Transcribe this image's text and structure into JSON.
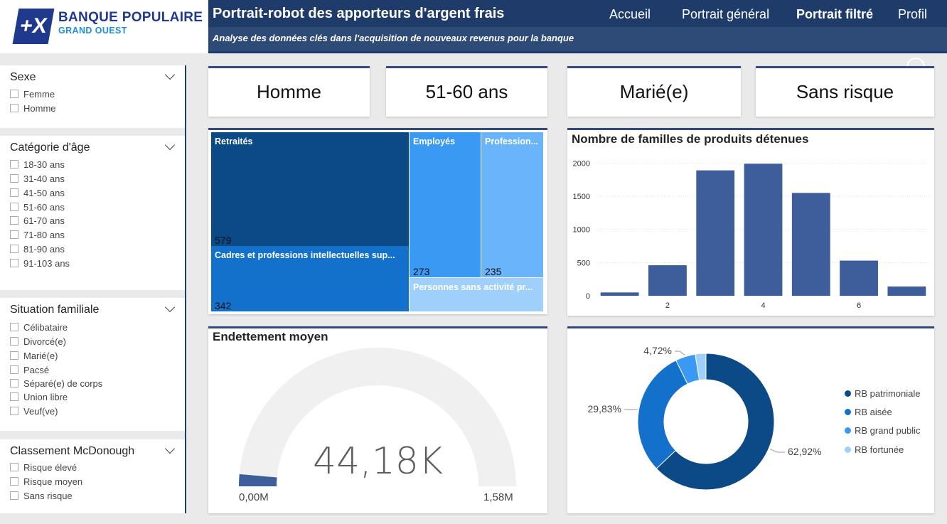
{
  "logo": {
    "mark": "+X",
    "name": "BANQUE POPULAIRE",
    "sub": "GRAND OUEST"
  },
  "header": {
    "title": "Portrait-robot des apporteurs d'argent frais",
    "subtitle": "Analyse des données clés dans l'acquisition de nouveaux revenus pour la banque",
    "nav": [
      "Accueil",
      "Portrait général",
      "Portrait filtré",
      "Profil"
    ],
    "active_nav": "Portrait filtré",
    "back_icon": "arrow-left-circle-icon"
  },
  "slicers": [
    {
      "title": "Sexe",
      "options": [
        "Femme",
        "Homme"
      ]
    },
    {
      "title": "Catégorie d'âge",
      "options": [
        "18-30 ans",
        "31-40 ans",
        "41-50 ans",
        "51-60 ans",
        "61-70 ans",
        "71-80 ans",
        "81-90 ans",
        "91-103 ans"
      ]
    },
    {
      "title": "Situation familiale",
      "options": [
        "Célibataire",
        "Divorcé(e)",
        "Marié(e)",
        "Pacsé",
        "Séparé(e) de corps",
        "Union libre",
        "Veuf(ve)"
      ]
    },
    {
      "title": "Classement McDonough",
      "options": [
        "Risque élevé",
        "Risque moyen",
        "Sans risque"
      ]
    }
  ],
  "cards": [
    "Homme",
    "51-60 ans",
    "Marié(e)",
    "Sans risque"
  ],
  "treemap": {
    "tiles": [
      {
        "label": "Retraités",
        "value": "579",
        "color": "#0b4a86"
      },
      {
        "label": "Cadres et professions intellectuelles sup...",
        "value": "342",
        "color": "#1471cb"
      },
      {
        "label": "Employés",
        "value": "273",
        "color": "#3a9af3"
      },
      {
        "label": "Profession...",
        "value": "235",
        "color": "#69b4fa"
      },
      {
        "label": "Personnes sans activité pr...",
        "value": "",
        "color": "#9fd0fc"
      }
    ]
  },
  "gauge": {
    "title": "Endettement moyen",
    "value_label": "44,18K",
    "min_label": "0,00M",
    "max_label": "1,58M",
    "fraction": 0.028
  },
  "chart_data": [
    {
      "type": "bar",
      "title": "Nombre de familles de produits détenues",
      "x": [
        1,
        2,
        3,
        4,
        5,
        6,
        7
      ],
      "values": [
        50,
        460,
        1890,
        1990,
        1550,
        530,
        140
      ],
      "xticks": [
        "2",
        "4",
        "6"
      ],
      "yticks": [
        "0",
        "500",
        "1000",
        "1500",
        "2000"
      ],
      "ylim": [
        0,
        2100
      ],
      "color": "#3e5d9b"
    },
    {
      "type": "pie",
      "donut": true,
      "labels": [
        "RB patrimoniale",
        "RB aisée",
        "RB grand public",
        "RB fortunée"
      ],
      "values": [
        62.92,
        29.83,
        4.72,
        2.53
      ],
      "data_labels": [
        "62,92%",
        "29,83%",
        "4,72%"
      ],
      "colors": [
        "#0b4a86",
        "#1471cb",
        "#3a9af3",
        "#9fd0fc"
      ],
      "legend": "right"
    }
  ]
}
